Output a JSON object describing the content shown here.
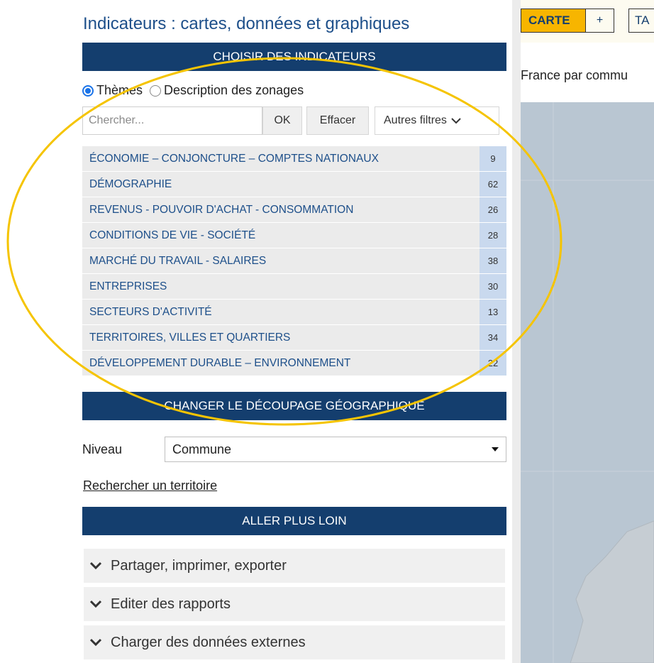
{
  "app_title": "Indicateurs : cartes, données et graphiques",
  "sections": {
    "choose_indicators": "CHOISIR DES INDICATEURS",
    "change_geo": "CHANGER LE DÉCOUPAGE GÉOGRAPHIQUE",
    "go_further": "ALLER PLUS LOIN"
  },
  "mode": {
    "options": [
      "Thèmes",
      "Description des zonages"
    ],
    "selected": "Thèmes"
  },
  "search": {
    "placeholder": "Chercher...",
    "ok_label": "OK",
    "clear_label": "Effacer",
    "filters_label": "Autres filtres"
  },
  "themes": [
    {
      "label": "ÉCONOMIE – CONJONCTURE – COMPTES NATIONAUX",
      "count": "9"
    },
    {
      "label": "DÉMOGRAPHIE",
      "count": "62"
    },
    {
      "label": "REVENUS - POUVOIR D'ACHAT - CONSOMMATION",
      "count": "26"
    },
    {
      "label": "CONDITIONS DE VIE - SOCIÉTÉ",
      "count": "28"
    },
    {
      "label": "MARCHÉ DU TRAVAIL - SALAIRES",
      "count": "38"
    },
    {
      "label": "ENTREPRISES",
      "count": "30"
    },
    {
      "label": "SECTEURS D'ACTIVITÉ",
      "count": "13"
    },
    {
      "label": "TERRITOIRES, VILLES ET QUARTIERS",
      "count": "34"
    },
    {
      "label": "DÉVELOPPEMENT DURABLE – ENVIRONNEMENT",
      "count": "22"
    }
  ],
  "level": {
    "label": "Niveau",
    "value": "Commune"
  },
  "search_territory_link": "Rechercher un territoire",
  "accordion": [
    "Partager, imprimer, exporter",
    "Editer des rapports",
    "Charger des données externes"
  ],
  "right": {
    "tab_carte": "CARTE",
    "tab_plus": "+",
    "tab_table": "TA",
    "map_caption": "France par commu"
  },
  "colors": {
    "brand_navy": "#143e6e",
    "accent_yellow": "#f7b500",
    "highlight": "#f5c400",
    "count_bg": "#c9d9ee",
    "map_sea": "#b9c6d2"
  }
}
